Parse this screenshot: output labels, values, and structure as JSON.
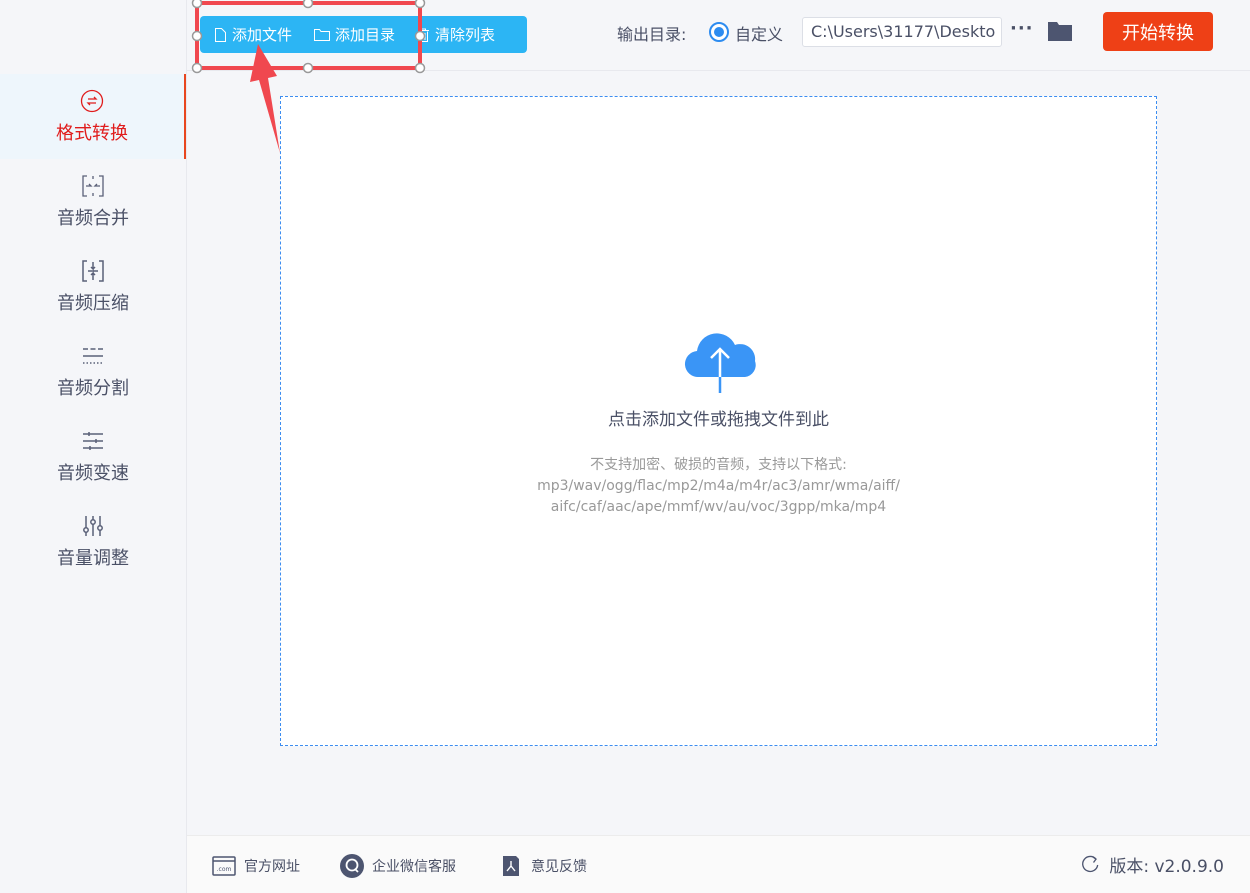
{
  "sidebar": {
    "items": [
      {
        "label": "格式转换",
        "icon": "convert-icon",
        "active": true
      },
      {
        "label": "音频合并",
        "icon": "merge-icon"
      },
      {
        "label": "音频压缩",
        "icon": "compress-icon"
      },
      {
        "label": "音频分割",
        "icon": "split-icon"
      },
      {
        "label": "音频变速",
        "icon": "speed-icon"
      },
      {
        "label": "音量调整",
        "icon": "volume-sliders-icon"
      }
    ]
  },
  "toolbar": {
    "add_file": "添加文件",
    "add_folder": "添加目录",
    "clear_list": "清除列表"
  },
  "output": {
    "label": "输出目录:",
    "radio_label": "自定义",
    "path": "C:\\Users\\31177\\Deskto",
    "more": "···"
  },
  "start_button": "开始转换",
  "dropzone": {
    "title": "点击添加文件或拖拽文件到此",
    "hint_line1": "不支持加密、破损的音频，支持以下格式:",
    "hint_line2": "mp3/wav/ogg/flac/mp2/m4a/m4r/ac3/amr/wma/aiff/",
    "hint_line3": "aifc/caf/aac/ape/mmf/wv/au/voc/3gpp/mka/mp4"
  },
  "footer": {
    "website": "官方网址",
    "support": "企业微信客服",
    "feedback": "意见反馈",
    "version": "版本: v2.0.9.0"
  },
  "colors": {
    "accent": "#2cb5f4",
    "start": "#ee4016",
    "active": "#e01c1c",
    "annotation": "#f0484f"
  }
}
